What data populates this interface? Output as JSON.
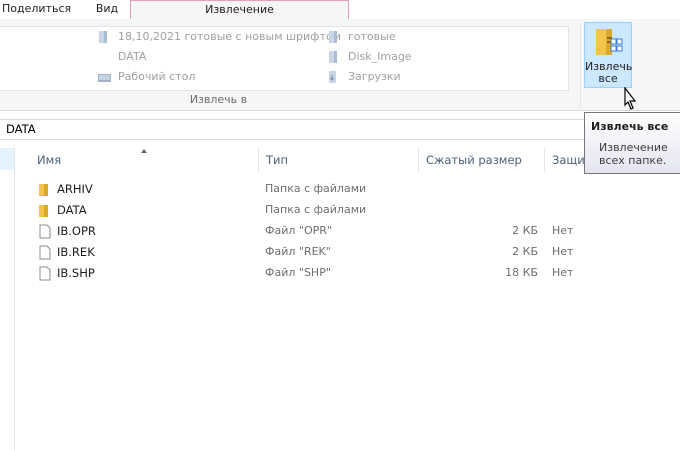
{
  "tabs": {
    "share": "Поделиться",
    "view": "Вид",
    "extract": "Извлечение"
  },
  "ribbon": {
    "destinations": [
      {
        "label": "18,10,2021 готовые с новым шрифтом",
        "icon": "folder-icon"
      },
      {
        "label": "DATA",
        "icon": "folder-icon"
      },
      {
        "label": "Рабочий стол",
        "icon": "desktop-icon"
      },
      {
        "label": "готовые",
        "icon": "folder-icon"
      },
      {
        "label": "Disk_Image",
        "icon": "folder-icon"
      },
      {
        "label": "Загрузки",
        "icon": "downloads-icon"
      }
    ],
    "group_label": "Извлечь в",
    "extract_all_line1": "Извлечь",
    "extract_all_line2": "все"
  },
  "address": {
    "path": "DATA"
  },
  "columns": {
    "name": "Имя",
    "type": "Тип",
    "compressed_size": "Сжатый размер",
    "protected": "Защи"
  },
  "files": [
    {
      "name": "ARHIV",
      "type": "Папка с файлами",
      "size": "",
      "protected": "",
      "icon": "folder-icon"
    },
    {
      "name": "DATA",
      "type": "Папка с файлами",
      "size": "",
      "protected": "",
      "icon": "folder-icon"
    },
    {
      "name": "IB.OPR",
      "type": "Файл \"OPR\"",
      "size": "2 КБ",
      "protected": "Нет",
      "icon": "file-icon"
    },
    {
      "name": "IB.REK",
      "type": "Файл \"REK\"",
      "size": "2 КБ",
      "protected": "Нет",
      "icon": "file-icon"
    },
    {
      "name": "IB.SHP",
      "type": "Файл \"SHP\"",
      "size": "18 КБ",
      "protected": "Нет",
      "icon": "file-icon"
    }
  ],
  "tooltip": {
    "title": "Извлечь все",
    "body": "Извлечение всех папке."
  },
  "colors": {
    "accent_tab_border": "#e7a1b0",
    "selected_button": "#cce8ff",
    "folder": "#e8b33f"
  }
}
